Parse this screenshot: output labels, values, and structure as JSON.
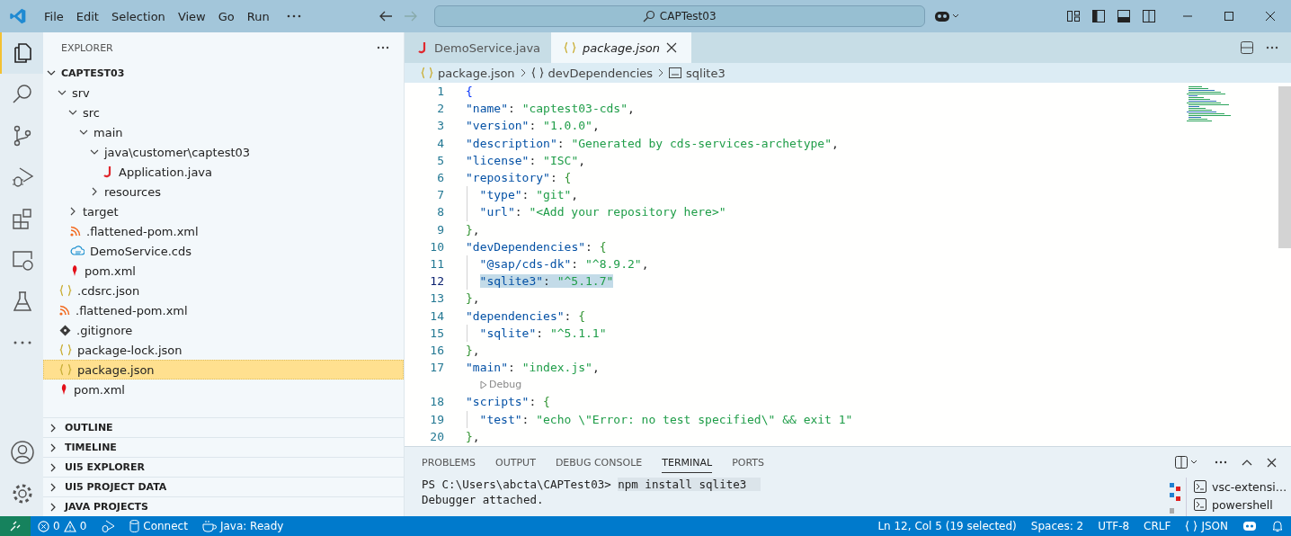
{
  "menu": [
    "File",
    "Edit",
    "Selection",
    "View",
    "Go",
    "Run"
  ],
  "command_center": "CAPTest03",
  "explorer": {
    "title": "EXPLORER",
    "root": {
      "label": "CAPTEST03",
      "expanded": true,
      "children": [
        {
          "label": "srv",
          "kind": "folder",
          "expanded": true,
          "selected": false,
          "children": [
            {
              "label": "src",
              "kind": "folder",
              "expanded": true,
              "selected": false,
              "children": [
                {
                  "label": "main",
                  "kind": "folder",
                  "expanded": true,
                  "selected": false,
                  "children": [
                    {
                      "label": "java\\customer\\captest03",
                      "kind": "folder",
                      "expanded": true,
                      "selected": false,
                      "children": [
                        {
                          "label": "Application.java",
                          "kind": "java",
                          "selected": false
                        }
                      ]
                    },
                    {
                      "label": "resources",
                      "kind": "folder",
                      "expanded": false,
                      "selected": false
                    }
                  ]
                }
              ]
            },
            {
              "label": "target",
              "kind": "folder",
              "expanded": false,
              "selected": false
            },
            {
              "label": ".flattened-pom.xml",
              "kind": "xml",
              "selected": false
            },
            {
              "label": "DemoService.cds",
              "kind": "cds",
              "selected": false
            },
            {
              "label": "pom.xml",
              "kind": "maven",
              "selected": false
            }
          ]
        },
        {
          "label": ".cdsrc.json",
          "kind": "json",
          "selected": false
        },
        {
          "label": ".flattened-pom.xml",
          "kind": "xml",
          "selected": false
        },
        {
          "label": ".gitignore",
          "kind": "git",
          "selected": false
        },
        {
          "label": "package-lock.json",
          "kind": "json",
          "selected": false
        },
        {
          "label": "package.json",
          "kind": "json",
          "selected": true
        },
        {
          "label": "pom.xml",
          "kind": "maven",
          "selected": false
        }
      ]
    }
  },
  "sections": [
    {
      "label": "OUTLINE",
      "expanded": false
    },
    {
      "label": "TIMELINE",
      "expanded": false
    },
    {
      "label": "UI5 EXPLORER",
      "expanded": false
    },
    {
      "label": "UI5 PROJECT DATA",
      "expanded": false
    },
    {
      "label": "JAVA PROJECTS",
      "expanded": false
    }
  ],
  "tabs": [
    {
      "label": "DemoService.java",
      "kind": "java",
      "selected": false
    },
    {
      "label": "package.json",
      "kind": "json",
      "selected": true
    }
  ],
  "breadcrumb": [
    {
      "label": "package.json",
      "kind": "json"
    },
    {
      "label": "devDependencies",
      "kind": "object"
    },
    {
      "label": "sqlite3",
      "kind": "string"
    }
  ],
  "code": [
    {
      "kind": "code",
      "number": "1",
      "selected": false,
      "tokens": [
        {
          "kind": "outer",
          "text": "{"
        }
      ],
      "children": [
        {
          "kind": "code",
          "number": "2",
          "selected": false,
          "tokens": [
            {
              "kind": "key",
              "text": "\"name\""
            },
            {
              "kind": "punct",
              "text": ": "
            },
            {
              "kind": "str",
              "text": "\"captest03-cds\""
            },
            {
              "kind": "punct",
              "text": ","
            }
          ]
        },
        {
          "kind": "code",
          "number": "3",
          "selected": false,
          "tokens": [
            {
              "kind": "key",
              "text": "\"version\""
            },
            {
              "kind": "punct",
              "text": ": "
            },
            {
              "kind": "str",
              "text": "\"1.0.0\""
            },
            {
              "kind": "punct",
              "text": ","
            }
          ]
        },
        {
          "kind": "code",
          "number": "4",
          "selected": false,
          "tokens": [
            {
              "kind": "key",
              "text": "\"description\""
            },
            {
              "kind": "punct",
              "text": ": "
            },
            {
              "kind": "str",
              "text": "\"Generated by cds-services-archetype\""
            },
            {
              "kind": "punct",
              "text": ","
            }
          ]
        },
        {
          "kind": "code",
          "number": "5",
          "selected": false,
          "tokens": [
            {
              "kind": "key",
              "text": "\"license\""
            },
            {
              "kind": "punct",
              "text": ": "
            },
            {
              "kind": "str",
              "text": "\"ISC\""
            },
            {
              "kind": "punct",
              "text": ","
            }
          ]
        },
        {
          "kind": "code",
          "number": "6",
          "selected": false,
          "tokens": [
            {
              "kind": "key",
              "text": "\"repository\""
            },
            {
              "kind": "punct",
              "text": ": "
            },
            {
              "kind": "inner",
              "text": "{"
            }
          ],
          "children": [
            {
              "kind": "code",
              "number": "7",
              "selected": false,
              "tokens": [
                {
                  "kind": "key",
                  "text": "\"type\""
                },
                {
                  "kind": "punct",
                  "text": ": "
                },
                {
                  "kind": "str",
                  "text": "\"git\""
                },
                {
                  "kind": "punct",
                  "text": ","
                }
              ]
            },
            {
              "kind": "code",
              "number": "8",
              "selected": false,
              "tokens": [
                {
                  "kind": "key",
                  "text": "\"url\""
                },
                {
                  "kind": "punct",
                  "text": ": "
                },
                {
                  "kind": "str",
                  "text": "\"<Add your repository here>\""
                }
              ]
            }
          ]
        },
        {
          "kind": "code",
          "number": "9",
          "selected": false,
          "tokens": [
            {
              "kind": "inner",
              "text": "}"
            },
            {
              "kind": "punct",
              "text": ","
            }
          ]
        },
        {
          "kind": "code",
          "number": "10",
          "selected": false,
          "tokens": [
            {
              "kind": "key",
              "text": "\"devDependencies\""
            },
            {
              "kind": "punct",
              "text": ": "
            },
            {
              "kind": "inner",
              "text": "{"
            }
          ],
          "children": [
            {
              "kind": "code",
              "number": "11",
              "selected": false,
              "tokens": [
                {
                  "kind": "key",
                  "text": "\"@sap/cds-dk\""
                },
                {
                  "kind": "punct",
                  "text": ": "
                },
                {
                  "kind": "str",
                  "text": "\"^8.9.2\""
                },
                {
                  "kind": "punct",
                  "text": ","
                }
              ]
            },
            {
              "kind": "code",
              "number": "12",
              "selected": true,
              "tokens": [
                {
                  "kind": "key",
                  "text": "\"sqlite3\""
                },
                {
                  "kind": "punct",
                  "text": ": "
                },
                {
                  "kind": "str",
                  "text": "\"^5.1.7\""
                }
              ]
            }
          ]
        },
        {
          "kind": "code",
          "number": "13",
          "selected": false,
          "tokens": [
            {
              "kind": "inner",
              "text": "}"
            },
            {
              "kind": "punct",
              "text": ","
            }
          ]
        },
        {
          "kind": "code",
          "number": "14",
          "selected": false,
          "tokens": [
            {
              "kind": "key",
              "text": "\"dependencies\""
            },
            {
              "kind": "punct",
              "text": ": "
            },
            {
              "kind": "inner",
              "text": "{"
            }
          ],
          "children": [
            {
              "kind": "code",
              "number": "15",
              "selected": false,
              "tokens": [
                {
                  "kind": "key",
                  "text": "\"sqlite\""
                },
                {
                  "kind": "punct",
                  "text": ": "
                },
                {
                  "kind": "str",
                  "text": "\"^5.1.1\""
                }
              ]
            }
          ]
        },
        {
          "kind": "code",
          "number": "16",
          "selected": false,
          "tokens": [
            {
              "kind": "inner",
              "text": "}"
            },
            {
              "kind": "punct",
              "text": ","
            }
          ]
        },
        {
          "kind": "code",
          "number": "17",
          "selected": false,
          "tokens": [
            {
              "kind": "key",
              "text": "\"main\""
            },
            {
              "kind": "punct",
              "text": ": "
            },
            {
              "kind": "str",
              "text": "\"index.js\""
            },
            {
              "kind": "punct",
              "text": ","
            }
          ]
        },
        {
          "kind": "lens",
          "label": "Debug"
        },
        {
          "kind": "code",
          "number": "18",
          "selected": false,
          "tokens": [
            {
              "kind": "key",
              "text": "\"scripts\""
            },
            {
              "kind": "punct",
              "text": ": "
            },
            {
              "kind": "inner",
              "text": "{"
            }
          ],
          "children": [
            {
              "kind": "code",
              "number": "19",
              "selected": false,
              "tokens": [
                {
                  "kind": "key",
                  "text": "\"test\""
                },
                {
                  "kind": "punct",
                  "text": ": "
                },
                {
                  "kind": "str",
                  "text": "\"echo \\\"Error: no test specified\\\" && exit 1\""
                }
              ]
            }
          ]
        },
        {
          "kind": "code",
          "number": "20",
          "selected": false,
          "tokens": [
            {
              "kind": "inner",
              "text": "}"
            },
            {
              "kind": "punct",
              "text": ","
            }
          ]
        }
      ]
    }
  ],
  "panel": {
    "tabs": [
      {
        "label": "PROBLEMS",
        "selected": false
      },
      {
        "label": "OUTPUT",
        "selected": false
      },
      {
        "label": "DEBUG CONSOLE",
        "selected": false
      },
      {
        "label": "TERMINAL",
        "selected": true
      },
      {
        "label": "PORTS",
        "selected": false
      }
    ],
    "prompt": "PS C:\\Users\\abcta\\CAPTest03>",
    "command": "npm install sqlite3",
    "output": "Debugger attached.",
    "terminals": [
      {
        "label": "vsc-extensi…",
        "selected": false
      },
      {
        "label": "powershell",
        "selected": false
      }
    ]
  },
  "status_bar": {
    "problems": {
      "errors": "0",
      "warnings": "0"
    },
    "left": [
      "Connect",
      "Java: Ready"
    ],
    "right": [
      "Ln 12, Col 5 (19 selected)",
      "Spaces: 2",
      "UTF-8",
      "CRLF"
    ],
    "language": "JSON"
  }
}
